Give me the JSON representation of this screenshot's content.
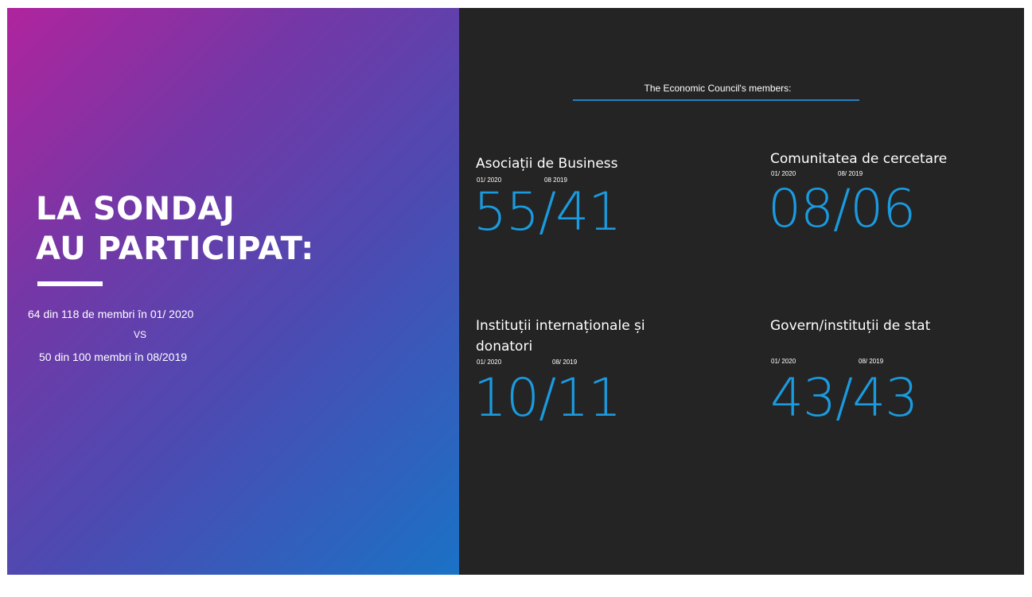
{
  "left": {
    "title_line1": "LA SONDAJ",
    "title_line2": "AU PARTICIPAT:",
    "stat_line1": "64 din 118 de membri în 01/ 2020",
    "stat_vs": "VS",
    "stat_line2": "50 din 100 membri în 08/2019"
  },
  "right": {
    "header": "The Economic Council's members:",
    "categories": [
      {
        "title": "Asociații de Business",
        "date1": "01/ 2020",
        "date2": "08 2019",
        "value": "55/41"
      },
      {
        "title": "Comunitatea de cercetare",
        "date1": "01/ 2020",
        "date2": "08/ 2019",
        "value": "08/06"
      },
      {
        "title": "Instituții internaționale și",
        "title_line2": "donatori",
        "date1": "01/ 2020",
        "date2": "08/ 2019",
        "value": "10/11"
      },
      {
        "title": "Govern/instituții de stat",
        "date1": "01/ 2020",
        "date2": "08/ 2019",
        "value": "43/43"
      }
    ]
  },
  "colors": {
    "gradient_start": "#b0249e",
    "gradient_end": "#1a72c6",
    "dark_panel": "#242424",
    "accent_blue": "#1a9be0"
  }
}
